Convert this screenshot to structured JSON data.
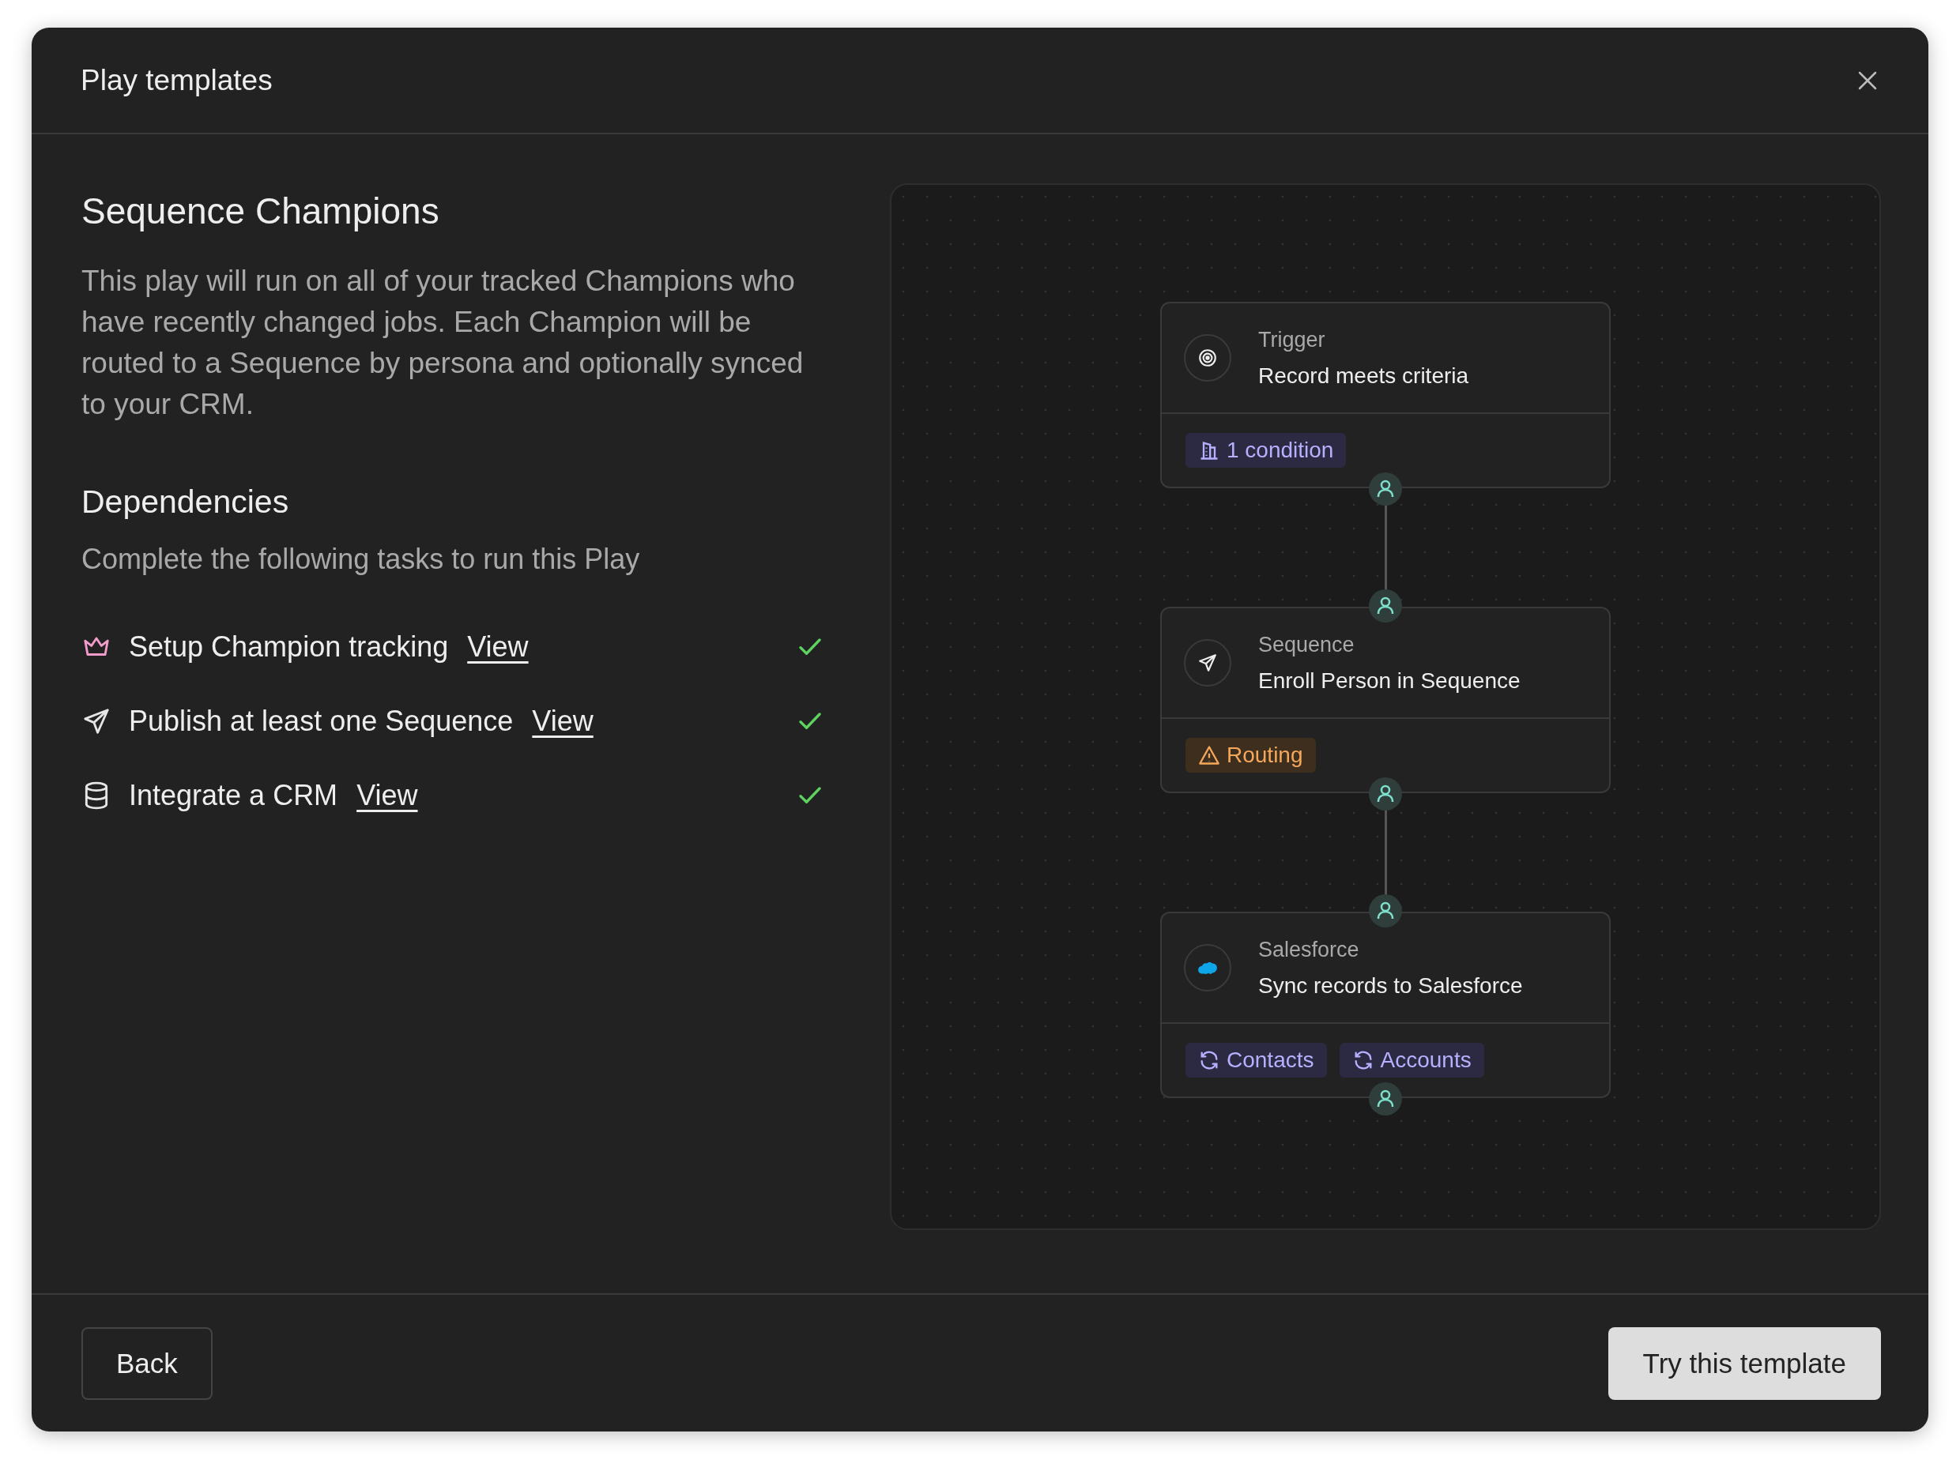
{
  "dialog": {
    "title": "Play templates"
  },
  "play": {
    "title": "Sequence Champions",
    "description": "This play will run on all of your tracked Champions who have recently changed jobs. Each Champion will be routed to a Sequence by persona and optionally synced to your CRM."
  },
  "dependencies": {
    "title": "Dependencies",
    "subtitle": "Complete the following tasks to run this Play",
    "tasks": [
      {
        "kind": "crown",
        "label": "Setup Champion tracking",
        "link": "View",
        "done": true
      },
      {
        "kind": "send",
        "label": "Publish at least one Sequence",
        "link": "View",
        "done": true
      },
      {
        "kind": "database",
        "label": "Integrate a CRM",
        "link": "View",
        "done": true
      }
    ]
  },
  "flow": {
    "nodes": [
      {
        "kind": "target",
        "category": "Trigger",
        "title": "Record meets criteria",
        "tags": [
          {
            "kind": "condition",
            "label": "1 condition"
          }
        ]
      },
      {
        "kind": "send",
        "category": "Sequence",
        "title": "Enroll Person in Sequence",
        "tags": [
          {
            "kind": "warning",
            "label": "Routing"
          }
        ]
      },
      {
        "kind": "cloud",
        "category": "Salesforce",
        "title": "Sync records to Salesforce",
        "tags": [
          {
            "kind": "sync",
            "label": "Contacts"
          },
          {
            "kind": "sync",
            "label": "Accounts"
          }
        ]
      }
    ]
  },
  "footer": {
    "back": "Back",
    "primary": "Try this template"
  }
}
